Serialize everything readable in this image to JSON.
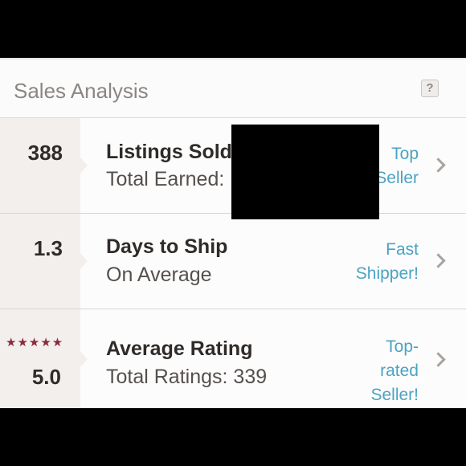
{
  "header": {
    "title": "Sales Analysis",
    "help_label": "?"
  },
  "rows": [
    {
      "value": "388",
      "title": "Listings Sold",
      "subtitle": "Total Earned:",
      "badge_lines": [
        "Top",
        "Seller"
      ]
    },
    {
      "value": "1.3",
      "title": "Days to Ship",
      "subtitle": "On Average",
      "badge_lines": [
        "Fast",
        "Shipper!"
      ]
    },
    {
      "value": "5.0",
      "stars": "★★★★★",
      "title": "Average Rating",
      "subtitle": "Total Ratings: 339",
      "badge_lines": [
        "Top-",
        "rated",
        "Seller!"
      ]
    }
  ],
  "colors": {
    "accent": "#4ba3c2",
    "star": "#8c2b3c",
    "stat_bg": "#f3efed"
  },
  "icons": {
    "help": "question-icon",
    "row_action": "chevron-right-icon"
  }
}
